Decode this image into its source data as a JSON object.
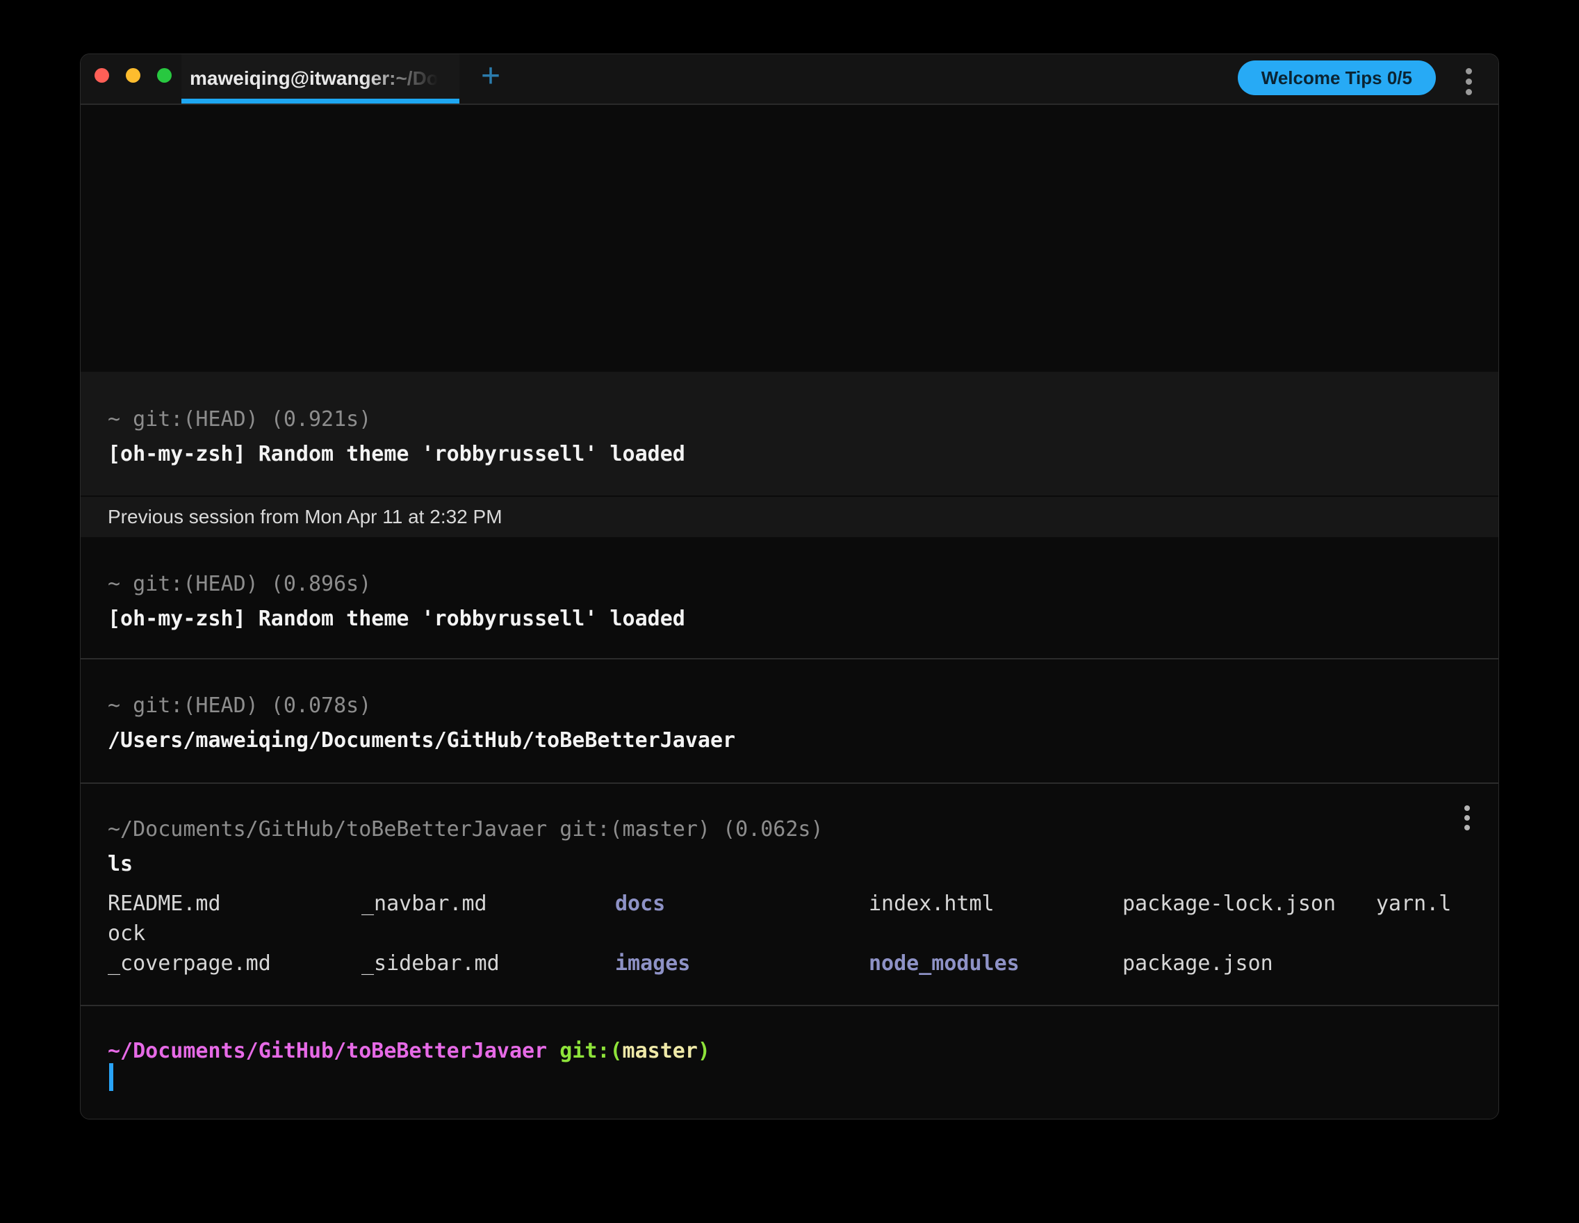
{
  "titlebar": {
    "tab_title": "maweiqing@itwanger:~/Docum",
    "new_tab_label": "+",
    "welcome_tips_label": "Welcome Tips 0/5"
  },
  "session_banner": "Previous session from Mon Apr 11 at 2:32 PM",
  "blocks": [
    {
      "header": "~ git:(HEAD) (0.921s)",
      "output": "[oh-my-zsh] Random theme 'robbyrussell' loaded"
    },
    {
      "header": "~ git:(HEAD) (0.896s)",
      "output": "[oh-my-zsh] Random theme 'robbyrussell' loaded"
    },
    {
      "header": "~ git:(HEAD) (0.078s)",
      "output": "/Users/maweiqing/Documents/GitHub/toBeBetterJavaer"
    },
    {
      "header": "~/Documents/GitHub/toBeBetterJavaer git:(master) (0.062s)",
      "command": "ls"
    }
  ],
  "listing": {
    "rows": [
      [
        {
          "text": "README.md",
          "type": "file"
        },
        {
          "text": "_navbar.md",
          "type": "file"
        },
        {
          "text": "docs",
          "type": "dir"
        },
        {
          "text": "index.html",
          "type": "file"
        },
        {
          "text": "package-lock.json",
          "type": "file"
        },
        {
          "text": "yarn.l",
          "type": "file"
        }
      ],
      [
        {
          "text": "ock",
          "type": "file"
        }
      ],
      [
        {
          "text": "_coverpage.md",
          "type": "file"
        },
        {
          "text": "_sidebar.md",
          "type": "file"
        },
        {
          "text": "images",
          "type": "dir"
        },
        {
          "text": "node_modules",
          "type": "dir"
        },
        {
          "text": "package.json",
          "type": "file"
        }
      ]
    ]
  },
  "prompt": {
    "path": "~/Documents/GitHub/toBeBetterJavaer",
    "git_prefix": " git:(",
    "branch": "master",
    "git_suffix": ")"
  },
  "colors": {
    "accent_blue": "#27aaf5",
    "tab_indicator_blue": "#1ea7f2",
    "block_background": "#171717",
    "header_gray": "#8d8d8d",
    "directory_purple": "#8e92c6",
    "prompt_path_pink": "#e66ae6",
    "prompt_git_green": "#8ee33a",
    "prompt_branch_yellow": "#efe9a8",
    "cursor_blue": "#29a3f5"
  }
}
